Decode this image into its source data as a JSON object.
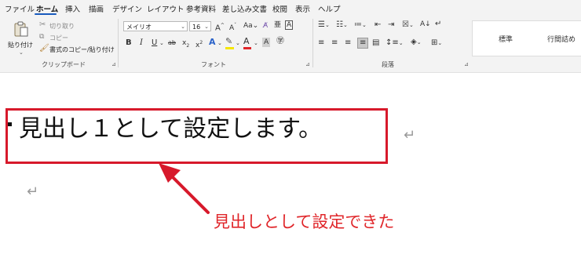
{
  "menu": {
    "tabs": [
      "ファイル",
      "ホーム",
      "挿入",
      "描画",
      "デザイン",
      "レイアウト",
      "参考資料",
      "差し込み文書",
      "校閲",
      "表示",
      "ヘルプ"
    ],
    "active_tab": "ホーム"
  },
  "clipboard": {
    "paste_label": "貼り付け",
    "cut_label": "切り取り",
    "copy_label": "コピー",
    "format_painter_label": "書式のコピー/貼り付け",
    "group_label": "クリップボード"
  },
  "font": {
    "font_name": "メイリオ",
    "font_size": "16",
    "group_label": "フォント"
  },
  "paragraph": {
    "group_label": "段落"
  },
  "styles": {
    "items": [
      "標準",
      "行間詰め"
    ]
  },
  "document": {
    "heading_text": "見出し１として設定します。",
    "callout_text": "見出しとして設定できた"
  },
  "colors": {
    "accent": "#185abd",
    "annotation_red": "#d7192b"
  }
}
